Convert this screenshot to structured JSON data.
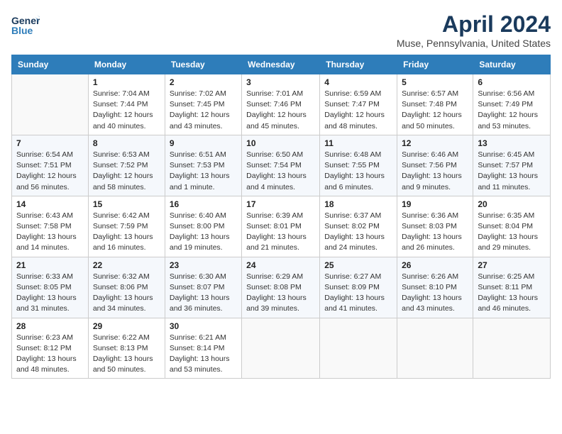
{
  "header": {
    "logo_line1": "General",
    "logo_line2": "Blue",
    "month_title": "April 2024",
    "location": "Muse, Pennsylvania, United States"
  },
  "columns": [
    "Sunday",
    "Monday",
    "Tuesday",
    "Wednesday",
    "Thursday",
    "Friday",
    "Saturday"
  ],
  "weeks": [
    [
      {
        "day": "",
        "sunrise": "",
        "sunset": "",
        "daylight": ""
      },
      {
        "day": "1",
        "sunrise": "7:04 AM",
        "sunset": "7:44 PM",
        "daylight": "12 hours and 40 minutes."
      },
      {
        "day": "2",
        "sunrise": "7:02 AM",
        "sunset": "7:45 PM",
        "daylight": "12 hours and 43 minutes."
      },
      {
        "day": "3",
        "sunrise": "7:01 AM",
        "sunset": "7:46 PM",
        "daylight": "12 hours and 45 minutes."
      },
      {
        "day": "4",
        "sunrise": "6:59 AM",
        "sunset": "7:47 PM",
        "daylight": "12 hours and 48 minutes."
      },
      {
        "day": "5",
        "sunrise": "6:57 AM",
        "sunset": "7:48 PM",
        "daylight": "12 hours and 50 minutes."
      },
      {
        "day": "6",
        "sunrise": "6:56 AM",
        "sunset": "7:49 PM",
        "daylight": "12 hours and 53 minutes."
      }
    ],
    [
      {
        "day": "7",
        "sunrise": "6:54 AM",
        "sunset": "7:51 PM",
        "daylight": "12 hours and 56 minutes."
      },
      {
        "day": "8",
        "sunrise": "6:53 AM",
        "sunset": "7:52 PM",
        "daylight": "12 hours and 58 minutes."
      },
      {
        "day": "9",
        "sunrise": "6:51 AM",
        "sunset": "7:53 PM",
        "daylight": "13 hours and 1 minute."
      },
      {
        "day": "10",
        "sunrise": "6:50 AM",
        "sunset": "7:54 PM",
        "daylight": "13 hours and 4 minutes."
      },
      {
        "day": "11",
        "sunrise": "6:48 AM",
        "sunset": "7:55 PM",
        "daylight": "13 hours and 6 minutes."
      },
      {
        "day": "12",
        "sunrise": "6:46 AM",
        "sunset": "7:56 PM",
        "daylight": "13 hours and 9 minutes."
      },
      {
        "day": "13",
        "sunrise": "6:45 AM",
        "sunset": "7:57 PM",
        "daylight": "13 hours and 11 minutes."
      }
    ],
    [
      {
        "day": "14",
        "sunrise": "6:43 AM",
        "sunset": "7:58 PM",
        "daylight": "13 hours and 14 minutes."
      },
      {
        "day": "15",
        "sunrise": "6:42 AM",
        "sunset": "7:59 PM",
        "daylight": "13 hours and 16 minutes."
      },
      {
        "day": "16",
        "sunrise": "6:40 AM",
        "sunset": "8:00 PM",
        "daylight": "13 hours and 19 minutes."
      },
      {
        "day": "17",
        "sunrise": "6:39 AM",
        "sunset": "8:01 PM",
        "daylight": "13 hours and 21 minutes."
      },
      {
        "day": "18",
        "sunrise": "6:37 AM",
        "sunset": "8:02 PM",
        "daylight": "13 hours and 24 minutes."
      },
      {
        "day": "19",
        "sunrise": "6:36 AM",
        "sunset": "8:03 PM",
        "daylight": "13 hours and 26 minutes."
      },
      {
        "day": "20",
        "sunrise": "6:35 AM",
        "sunset": "8:04 PM",
        "daylight": "13 hours and 29 minutes."
      }
    ],
    [
      {
        "day": "21",
        "sunrise": "6:33 AM",
        "sunset": "8:05 PM",
        "daylight": "13 hours and 31 minutes."
      },
      {
        "day": "22",
        "sunrise": "6:32 AM",
        "sunset": "8:06 PM",
        "daylight": "13 hours and 34 minutes."
      },
      {
        "day": "23",
        "sunrise": "6:30 AM",
        "sunset": "8:07 PM",
        "daylight": "13 hours and 36 minutes."
      },
      {
        "day": "24",
        "sunrise": "6:29 AM",
        "sunset": "8:08 PM",
        "daylight": "13 hours and 39 minutes."
      },
      {
        "day": "25",
        "sunrise": "6:27 AM",
        "sunset": "8:09 PM",
        "daylight": "13 hours and 41 minutes."
      },
      {
        "day": "26",
        "sunrise": "6:26 AM",
        "sunset": "8:10 PM",
        "daylight": "13 hours and 43 minutes."
      },
      {
        "day": "27",
        "sunrise": "6:25 AM",
        "sunset": "8:11 PM",
        "daylight": "13 hours and 46 minutes."
      }
    ],
    [
      {
        "day": "28",
        "sunrise": "6:23 AM",
        "sunset": "8:12 PM",
        "daylight": "13 hours and 48 minutes."
      },
      {
        "day": "29",
        "sunrise": "6:22 AM",
        "sunset": "8:13 PM",
        "daylight": "13 hours and 50 minutes."
      },
      {
        "day": "30",
        "sunrise": "6:21 AM",
        "sunset": "8:14 PM",
        "daylight": "13 hours and 53 minutes."
      },
      {
        "day": "",
        "sunrise": "",
        "sunset": "",
        "daylight": ""
      },
      {
        "day": "",
        "sunrise": "",
        "sunset": "",
        "daylight": ""
      },
      {
        "day": "",
        "sunrise": "",
        "sunset": "",
        "daylight": ""
      },
      {
        "day": "",
        "sunrise": "",
        "sunset": "",
        "daylight": ""
      }
    ]
  ]
}
